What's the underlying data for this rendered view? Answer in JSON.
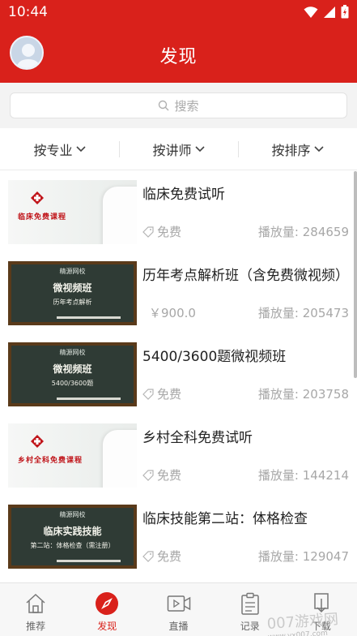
{
  "status_bar": {
    "time": "10:44"
  },
  "header": {
    "title": "发现"
  },
  "search": {
    "placeholder": "搜索"
  },
  "filters": [
    {
      "label": "按专业"
    },
    {
      "label": "按讲师"
    },
    {
      "label": "按排序"
    }
  ],
  "courses": [
    {
      "thumbnail_caption": "临床免费课程",
      "title": "临床免费试听",
      "price": "免费",
      "plays": "播放量: 284659"
    },
    {
      "thumbnail_brand": "精源网校",
      "thumbnail_heading": "微视频班",
      "thumbnail_sub": "历年考点解析",
      "title": "历年考点解析班（含免费微视频）",
      "price": "￥900.0",
      "plays": "播放量: 205473"
    },
    {
      "thumbnail_brand": "精源网校",
      "thumbnail_heading": "微视频班",
      "thumbnail_sub": "5400/3600题",
      "title": "5400/3600题微视频班",
      "price": "免费",
      "plays": "播放量: 203758"
    },
    {
      "thumbnail_caption": "乡村全科免费课程",
      "title": "乡村全科免费试听",
      "price": "免费",
      "plays": "播放量: 144214"
    },
    {
      "thumbnail_brand": "精源网校",
      "thumbnail_heading": "临床实践技能",
      "thumbnail_sub": "第二站：体格检查（需注册）",
      "title": "临床技能第二站：体格检查",
      "price": "免费",
      "plays": "播放量: 129047"
    }
  ],
  "tabs": [
    {
      "label": "推荐",
      "icon": "home-icon"
    },
    {
      "label": "发现",
      "icon": "compass-icon"
    },
    {
      "label": "直播",
      "icon": "video-icon"
    },
    {
      "label": "记录",
      "icon": "clipboard-icon"
    },
    {
      "label": "下载",
      "icon": "download-icon"
    }
  ],
  "watermark": {
    "brand": "007游戏网",
    "url": "www.yx007.com"
  },
  "colors": {
    "brand_red": "#d9211b",
    "muted_text": "#a7a7a7"
  }
}
